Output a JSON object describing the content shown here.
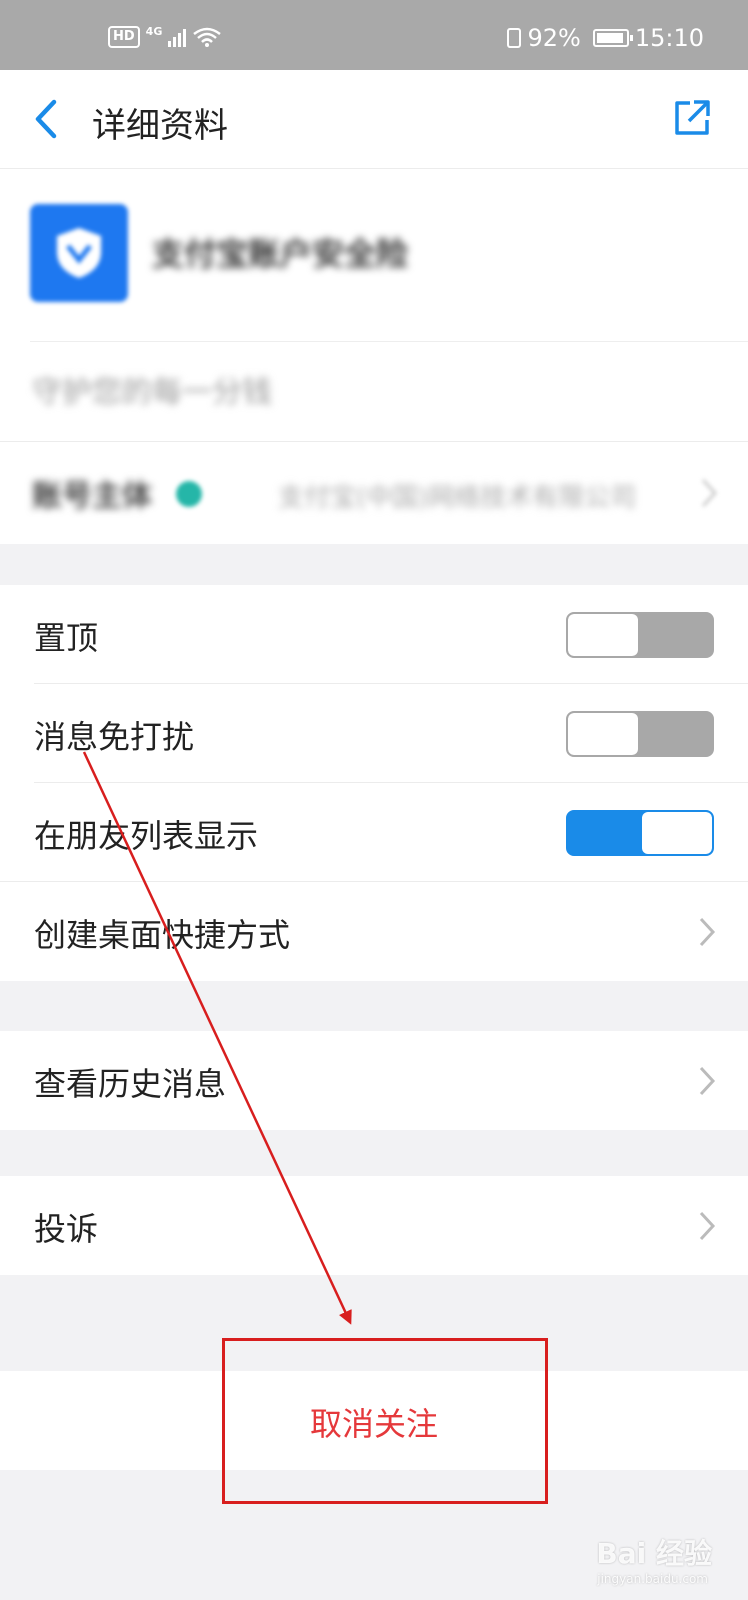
{
  "status_bar": {
    "hd": "HD",
    "network": "4G",
    "battery_percent": "92%",
    "battery_level": 0.92,
    "time": "15:10",
    "icons": [
      "hd-icon",
      "signal-icon",
      "wifi-icon",
      "vibrate-icon",
      "battery-icon"
    ]
  },
  "header": {
    "title": "详细资料",
    "back_icon": "chevron-left-icon",
    "share_icon": "share-external-icon"
  },
  "profile": {
    "name": "支付宝账户安全险",
    "slogan": "守护您的每一分钱",
    "owner_label": "账号主体",
    "owner_value": "支付宝(中国)网络技术有限公司"
  },
  "settings": {
    "pin_top": {
      "label": "置顶",
      "on": false
    },
    "mute": {
      "label": "消息免打扰",
      "on": false
    },
    "show_in_list": {
      "label": "在朋友列表显示",
      "on": true
    },
    "shortcut": {
      "label": "创建桌面快捷方式"
    },
    "history": {
      "label": "查看历史消息"
    },
    "complain": {
      "label": "投诉"
    }
  },
  "unfollow": {
    "label": "取消关注"
  },
  "watermark": {
    "text": "Bai 经验",
    "sub": "jingyan.baidu.com"
  },
  "colors": {
    "accent_blue": "#1a8be8",
    "danger_red": "#e5383b",
    "annotation_red": "#d81e1e",
    "status_bar_bg": "#a9a9a9"
  }
}
